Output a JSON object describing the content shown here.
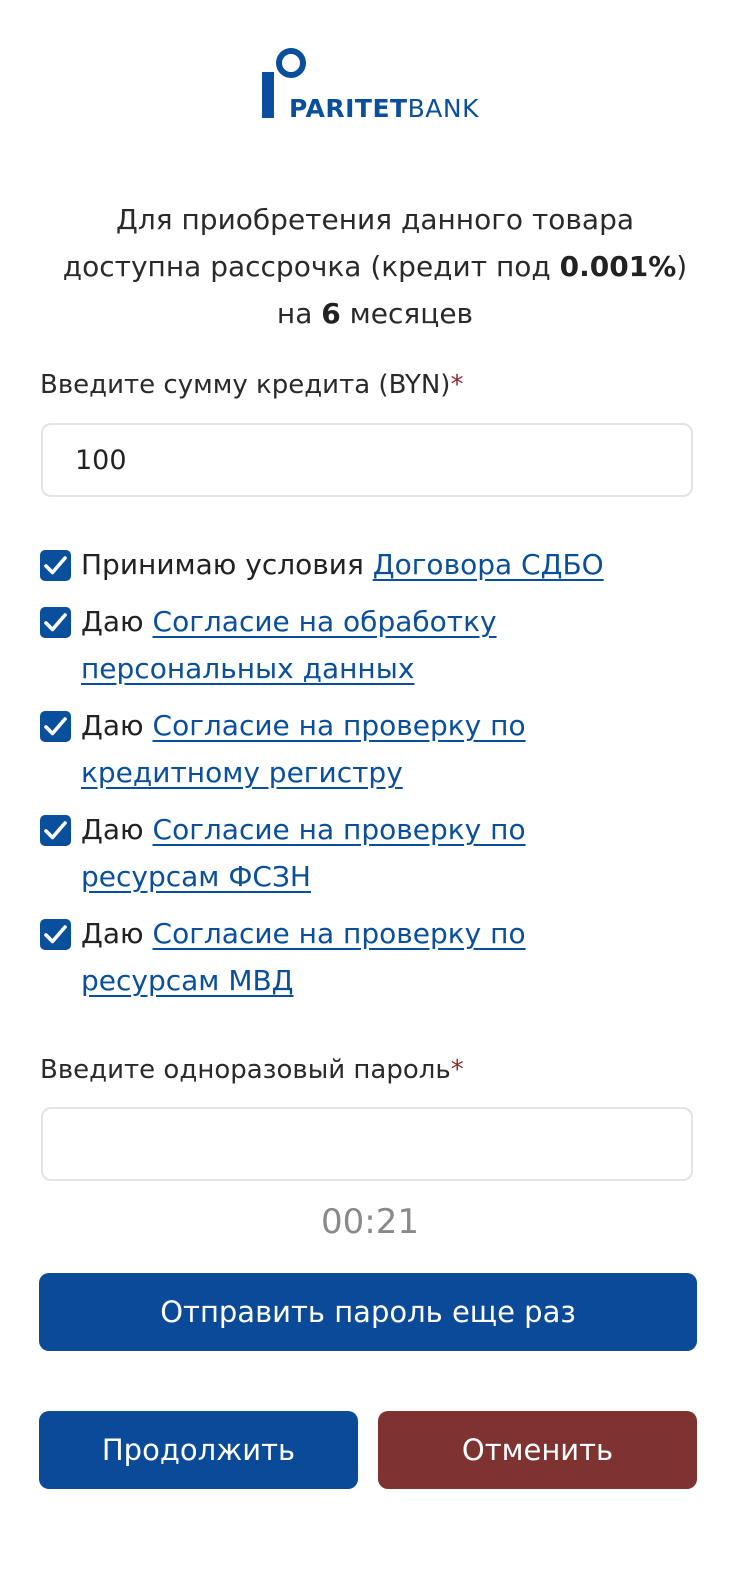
{
  "logo": {
    "word_bold": "PARITET",
    "word_light": "BANK"
  },
  "intro": {
    "line1": "Для приобретения данного товара",
    "line2_pre": "доступна рассрочка (кредит под ",
    "rate": "0.001%",
    "line2_post": ")",
    "line3_pre": "на ",
    "months": "6",
    "line3_post": " месяцев"
  },
  "amount": {
    "label": "Введите сумму кредита (BYN)",
    "required_mark": "*",
    "value": "100"
  },
  "consents": [
    {
      "prefix": "Принимаю условия ",
      "link": "Договора СДБО",
      "checked": true
    },
    {
      "prefix": "Даю ",
      "link": "Согласие на обработку персональных данных",
      "checked": true
    },
    {
      "prefix": "Даю ",
      "link": "Согласие на проверку по кредитному регистру",
      "checked": true
    },
    {
      "prefix": "Даю ",
      "link": "Согласие на проверку по ресурсам ФСЗН",
      "checked": true
    },
    {
      "prefix": "Даю ",
      "link": "Согласие на проверку по ресурсам МВД",
      "checked": true
    }
  ],
  "otp": {
    "label": "Введите одноразовый пароль",
    "required_mark": "*",
    "value": "",
    "timer": "00:21"
  },
  "buttons": {
    "resend": "Отправить пароль еще раз",
    "continue": "Продолжить",
    "cancel": "Отменить"
  },
  "colors": {
    "primary": "#0a4a99",
    "danger": "#7e3330",
    "link": "#0a4f9c"
  }
}
